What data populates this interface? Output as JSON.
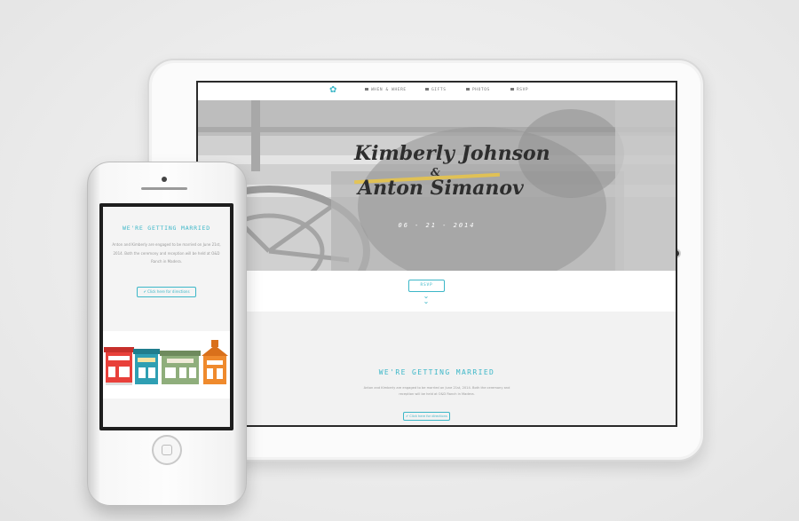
{
  "tablet": {
    "nav": {
      "items": [
        {
          "label": "WHEN & WHERE",
          "icon": "map-icon"
        },
        {
          "label": "GIFTS",
          "icon": "gift-icon"
        },
        {
          "label": "PHOTOS",
          "icon": "photo-icon"
        },
        {
          "label": "RSVP",
          "icon": "mail-icon"
        }
      ]
    },
    "hero": {
      "name1": "Kimberly Johnson",
      "amp": "&",
      "name2": "Anton Simanov",
      "date": "06 - 21 - 2014"
    },
    "rsvp_label": "RSVP",
    "info": {
      "heading": "WE'RE GETTING MARRIED",
      "body": "Anton and Kimberly are engaged to be married on June 21st, 2014. Both the ceremony and reception will be held at O&D Ranch in Madera.",
      "directions": "Click here for directions"
    }
  },
  "phone": {
    "heading": "WE'RE GETTING MARRIED",
    "body": "Anton and Kimberly are engaged to be married on June 21st, 2014. Both the ceremony and reception will be held at O&D Ranch in Madera.",
    "directions": "Click here for directions"
  },
  "colors": {
    "accent": "#3cb7c8",
    "ribbon": "#e7c44d",
    "building_red": "#e8403a",
    "building_teal": "#2f9fb3",
    "building_green": "#8fae7c",
    "building_orange": "#ef8a2d"
  }
}
